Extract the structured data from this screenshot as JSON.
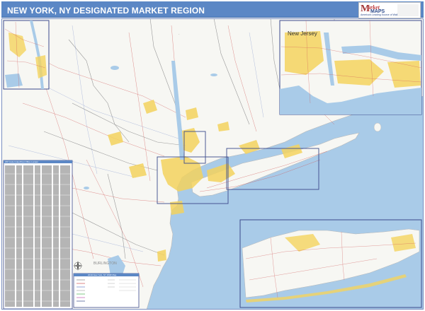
{
  "header": {
    "title": "NEW YORK, NY DESIGNATED MARKET REGION"
  },
  "logo": {
    "brand_first": "arket",
    "brand_second": "MAPS",
    "tagline": "America's Leading Source of Wall Maps",
    "icon": "market-maps-logo"
  },
  "labels": {
    "inset_new_jersey": "New Jersey",
    "burlington": "BURLINGTON"
  },
  "zip_index": {
    "title": "ZIP Code Index/Post Office Locator",
    "icon": "index-table-icon"
  },
  "legend": {
    "title": "2019 New York, NY DMR Map",
    "icon": "legend-icon"
  },
  "colors": {
    "header_blue": "#5b87c5",
    "water": "#a9cbe8",
    "land": "#f7f7f3",
    "urban": "#f4d35e",
    "inset_border": "#3b4a8c",
    "roads": "#d05454"
  }
}
